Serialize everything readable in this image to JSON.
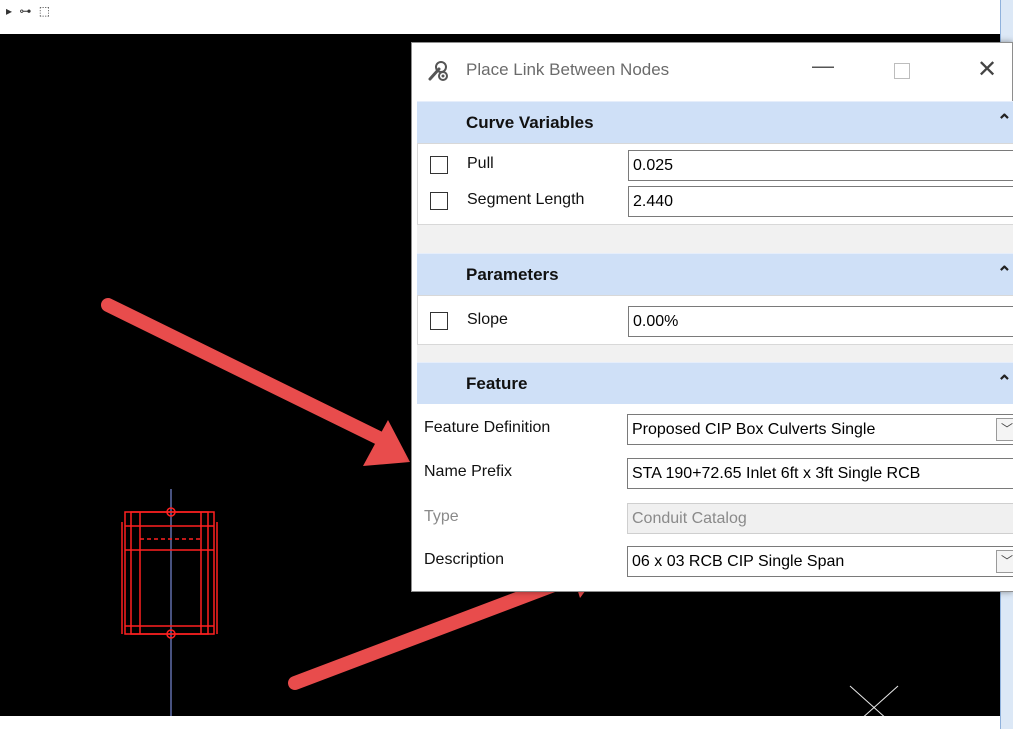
{
  "dialog": {
    "title": "Place Link Between Nodes",
    "icons": {
      "app": "wrench-gear-icon",
      "minimize": "minimize-icon",
      "maximize": "maximize-icon",
      "close": "close-icon"
    },
    "minimize_glyph": "—",
    "close_glyph": "✕"
  },
  "sections": {
    "curve_variables": {
      "title": "Curve Variables",
      "pull": {
        "label": "Pull",
        "value": "0.025",
        "checked": false
      },
      "segment_length": {
        "label": "Segment Length",
        "value": "2.440",
        "checked": false
      }
    },
    "parameters": {
      "title": "Parameters",
      "slope": {
        "label": "Slope",
        "value": "0.00%",
        "checked": false
      }
    },
    "feature": {
      "title": "Feature",
      "feature_definition": {
        "label": "Feature Definition",
        "value": "Proposed CIP Box Culverts Single"
      },
      "name_prefix": {
        "label": "Name Prefix",
        "value": "STA 190+72.65 Inlet 6ft x 3ft Single RCB"
      },
      "type": {
        "label": "Type",
        "value": "Conduit Catalog",
        "disabled": true
      },
      "description": {
        "label": "Description",
        "value": "06 x 03 RCB CIP Single Span"
      }
    },
    "collapse_glyph": "⌃"
  },
  "colors": {
    "section_header": "#cfe0f7",
    "annotation_arrow": "#e84c4c",
    "cad_element": "#ff2020",
    "viewport_bg": "#000000"
  },
  "toolbar_icons": [
    "snap-icon",
    "fence-icon"
  ]
}
